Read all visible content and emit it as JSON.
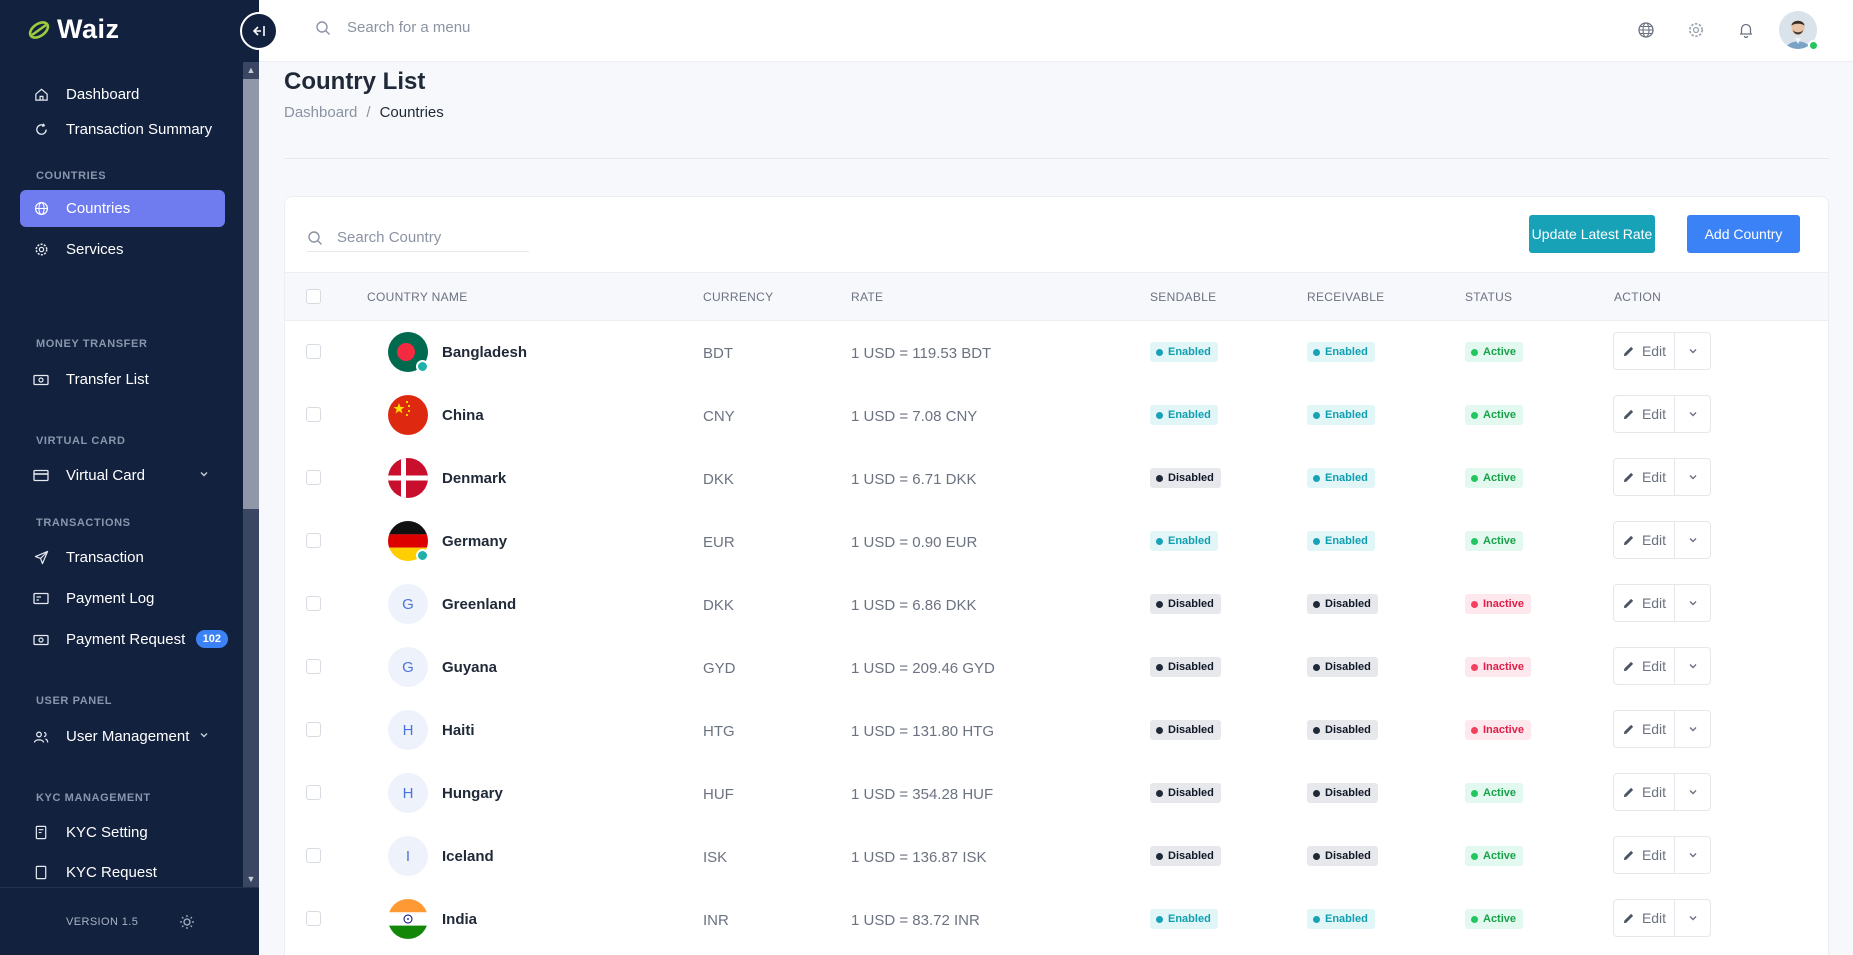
{
  "app": {
    "name": "Waiz",
    "version": "VERSION 1.5"
  },
  "topbar": {
    "search_placeholder": "Search for a menu"
  },
  "sidebar": {
    "items": [
      {
        "label": "Dashboard"
      },
      {
        "label": "Transaction Summary"
      }
    ],
    "sections": [
      {
        "title": "COUNTRIES",
        "items": [
          {
            "label": "Countries",
            "active": true
          },
          {
            "label": "Services"
          }
        ]
      },
      {
        "title": "MONEY TRANSFER",
        "items": [
          {
            "label": "Transfer List"
          }
        ]
      },
      {
        "title": "VIRTUAL CARD",
        "items": [
          {
            "label": "Virtual Card"
          }
        ]
      },
      {
        "title": "TRANSACTIONS",
        "items": [
          {
            "label": "Transaction"
          },
          {
            "label": "Payment Log"
          },
          {
            "label": "Payment Request",
            "badge": "102"
          }
        ]
      },
      {
        "title": "USER PANEL",
        "items": [
          {
            "label": "User Management"
          }
        ]
      },
      {
        "title": "KYC MANAGEMENT",
        "items": [
          {
            "label": "KYC Setting"
          },
          {
            "label": "KYC Request"
          }
        ]
      }
    ]
  },
  "page": {
    "title": "Country List",
    "breadcrumb": {
      "home": "Dashboard",
      "current": "Countries"
    }
  },
  "card": {
    "search_placeholder": "Search Country",
    "update_rate_label": "Update Latest Rate",
    "add_country_label": "Add Country"
  },
  "table": {
    "headers": {
      "country": "COUNTRY NAME",
      "currency": "CURRENCY",
      "rate": "RATE",
      "sendable": "SENDABLE",
      "receivable": "RECEIVABLE",
      "status": "STATUS",
      "action": "ACTION"
    },
    "edit_label": "Edit",
    "rows": [
      {
        "country": "Bangladesh",
        "initial": "",
        "flag": "bangladesh",
        "currency": "BDT",
        "rate": "1 USD = 119.53 BDT",
        "sendable": "Enabled",
        "receivable": "Enabled",
        "status": "Active"
      },
      {
        "country": "China",
        "initial": "",
        "flag": "china",
        "currency": "CNY",
        "rate": "1 USD = 7.08 CNY",
        "sendable": "Enabled",
        "receivable": "Enabled",
        "status": "Active"
      },
      {
        "country": "Denmark",
        "initial": "",
        "flag": "denmark",
        "currency": "DKK",
        "rate": "1 USD = 6.71 DKK",
        "sendable": "Disabled",
        "receivable": "Enabled",
        "status": "Active"
      },
      {
        "country": "Germany",
        "initial": "",
        "flag": "germany",
        "currency": "EUR",
        "rate": "1 USD = 0.90 EUR",
        "sendable": "Enabled",
        "receivable": "Enabled",
        "status": "Active"
      },
      {
        "country": "Greenland",
        "initial": "G",
        "flag": "",
        "currency": "DKK",
        "rate": "1 USD = 6.86 DKK",
        "sendable": "Disabled",
        "receivable": "Disabled",
        "status": "Inactive"
      },
      {
        "country": "Guyana",
        "initial": "G",
        "flag": "",
        "currency": "GYD",
        "rate": "1 USD = 209.46 GYD",
        "sendable": "Disabled",
        "receivable": "Disabled",
        "status": "Inactive"
      },
      {
        "country": "Haiti",
        "initial": "H",
        "flag": "",
        "currency": "HTG",
        "rate": "1 USD = 131.80 HTG",
        "sendable": "Disabled",
        "receivable": "Disabled",
        "status": "Inactive"
      },
      {
        "country": "Hungary",
        "initial": "H",
        "flag": "",
        "currency": "HUF",
        "rate": "1 USD = 354.28 HUF",
        "sendable": "Disabled",
        "receivable": "Disabled",
        "status": "Active"
      },
      {
        "country": "Iceland",
        "initial": "I",
        "flag": "",
        "currency": "ISK",
        "rate": "1 USD = 136.87 ISK",
        "sendable": "Disabled",
        "receivable": "Disabled",
        "status": "Active"
      },
      {
        "country": "India",
        "initial": "",
        "flag": "india",
        "currency": "INR",
        "rate": "1 USD = 83.72 INR",
        "sendable": "Enabled",
        "receivable": "Enabled",
        "status": "Active"
      }
    ]
  },
  "colors": {
    "sidebar_bg": "#12213e",
    "active_nav": "#6f7cf0",
    "update_btn": "#17a2b8",
    "add_btn": "#3b82f6"
  }
}
